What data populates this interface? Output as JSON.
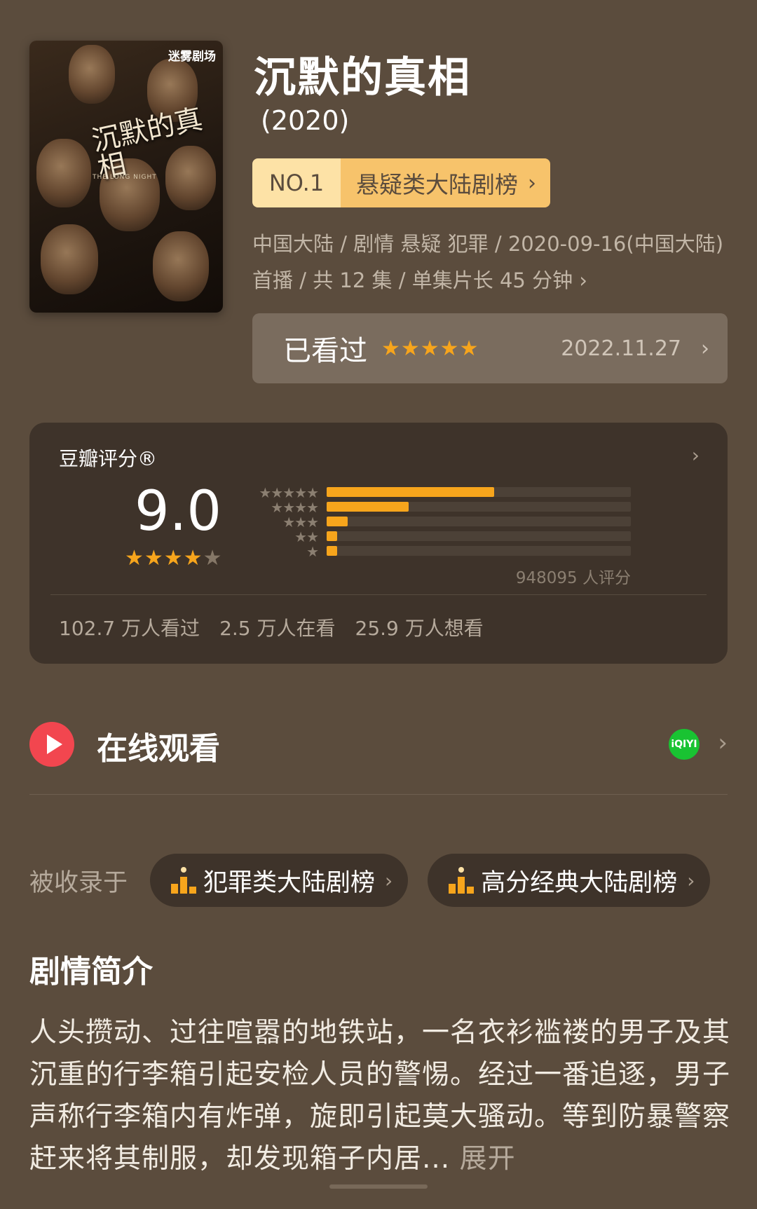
{
  "poster": {
    "logo_text": "迷雾剧场",
    "title_art": "沉默的真相",
    "subtitle_art": "THE LONG NIGHT"
  },
  "show": {
    "title": "沉默的真相",
    "year": "(2020)"
  },
  "rank": {
    "number": "NO.1",
    "name": "悬疑类大陆剧榜",
    "chevron": "›"
  },
  "meta": {
    "text": "中国大陆 / 剧情 悬疑 犯罪 / 2020-09-16(中国大陆) 首播 / 共 12 集 / 单集片长 45 分钟",
    "chevron": "›"
  },
  "watched": {
    "label": "已看过",
    "stars": "★★★★★",
    "date": "2022.11.27",
    "chevron": "›"
  },
  "rating": {
    "title": "豆瓣评分®",
    "chevron": "›",
    "score": "9.0",
    "score_stars_full": "★★★★",
    "score_stars_half": "★",
    "star_rows": [
      "★★★★★",
      "★★★★",
      "★★★",
      "★★",
      "★"
    ],
    "distribution": [
      0.55,
      0.27,
      0.07,
      0.035,
      0.035
    ],
    "count": "948095 人评分",
    "stats": [
      "102.7 万人看过",
      "2.5 万人在看",
      "25.9 万人想看"
    ],
    "accent_color": "#f7a51c"
  },
  "watch_online": {
    "label": "在线观看",
    "platform_icon": "iqiyi-icon",
    "platform_text": "iQIYI",
    "chevron": "›"
  },
  "included": {
    "label": "被收录于",
    "lists": [
      {
        "label": "犯罪类大陆剧榜",
        "chevron": "›"
      },
      {
        "label": "高分经典大陆剧榜",
        "chevron": "›"
      }
    ]
  },
  "synopsis": {
    "title": "剧情简介",
    "text": "人头攒动、过往喧嚣的地铁站，一名衣衫褴褛的男子及其沉重的行李箱引起安检人员的警惕。经过一番追逐，男子声称行李箱内有炸弹，旋即引起莫大骚动。等到防暴警察赶来将其制服，却发现箱子内居... ",
    "expand": "展开"
  }
}
